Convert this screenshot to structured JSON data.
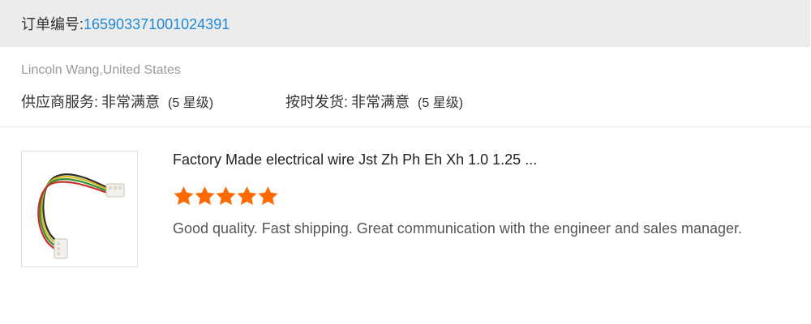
{
  "order": {
    "label": "订单编号:",
    "number": "165903371001024391",
    "link_color": "#1e88d6"
  },
  "reviewer": {
    "name_location": "Lincoln Wang,United States"
  },
  "ratings": [
    {
      "label": "供应商服务:",
      "value": "非常满意",
      "level": "(5 星级)"
    },
    {
      "label": "按时发货:",
      "value": "非常满意",
      "level": "(5 星级)"
    }
  ],
  "product": {
    "image_icon": "cable-assembly-image",
    "title": "Factory Made electrical wire Jst Zh Ph Eh Xh 1.0 1.25 ...",
    "stars": 5,
    "star_max": 5,
    "star_color": "#ff6a00",
    "review": "Good quality. Fast shipping. Great communication with the engineer and sales manager."
  }
}
